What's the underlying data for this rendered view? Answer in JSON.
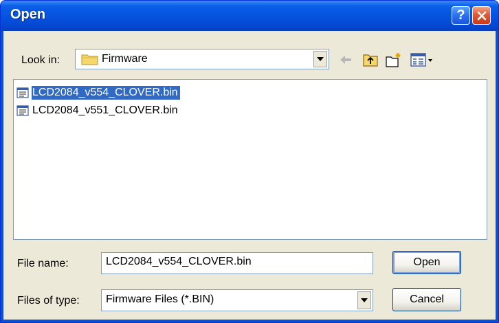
{
  "window": {
    "title": "Open"
  },
  "lookin": {
    "label": "Look in:",
    "value": "Firmware",
    "icon": "folder-icon"
  },
  "toolbar": {
    "back_icon": "back-arrow-icon",
    "up_icon": "up-one-level-icon",
    "new_folder_icon": "create-new-folder-icon",
    "view_icon": "view-menu-icon"
  },
  "files": [
    {
      "name": "LCD2084_v554_CLOVER.bin",
      "selected": true
    },
    {
      "name": "LCD2084_v551_CLOVER.bin",
      "selected": false
    }
  ],
  "filename": {
    "label": "File name:",
    "value": "LCD2084_v554_CLOVER.bin"
  },
  "filetype": {
    "label": "Files of type:",
    "value": "Firmware Files (*.BIN)"
  },
  "buttons": {
    "open": "Open",
    "cancel": "Cancel"
  },
  "colors": {
    "titlebar": "#0654e0",
    "selection": "#316ac5",
    "dialog_bg": "#ece9d8"
  }
}
